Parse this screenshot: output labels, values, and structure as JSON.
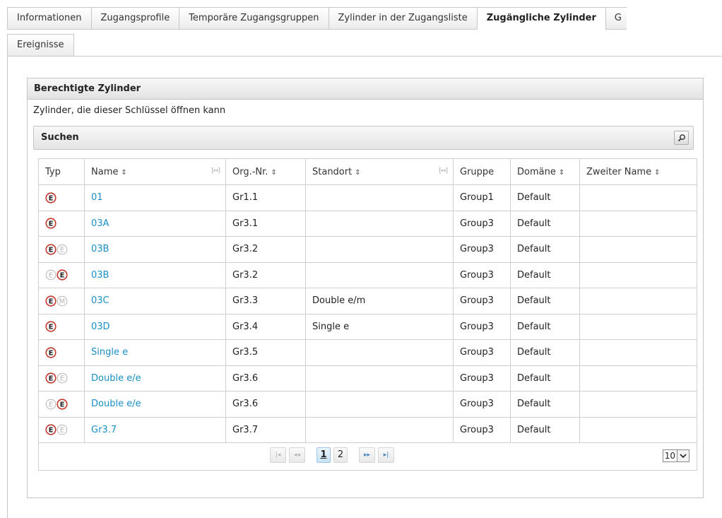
{
  "tabs_row1": [
    {
      "label": "Informationen",
      "active": false
    },
    {
      "label": "Zugangsprofile",
      "active": false
    },
    {
      "label": "Temporäre Zugangsgruppen",
      "active": false
    },
    {
      "label": "Zylinder in der Zugangsliste",
      "active": false
    },
    {
      "label": "Zugängliche Zylinder",
      "active": true
    },
    {
      "label": "G",
      "active": false
    }
  ],
  "tabs_row2": [
    {
      "label": "Ereignisse",
      "active": false
    }
  ],
  "panel": {
    "title": "Berechtigte Zylinder",
    "description": "Zylinder, die dieser Schlüssel öffnen kann",
    "search_label": "Suchen",
    "search_icon": "magnifier-icon"
  },
  "table": {
    "columns": [
      "Typ",
      "Name",
      "Org.-Nr.",
      "Standort",
      "Gruppe",
      "Domäne",
      "Zweiter Name"
    ],
    "sortable": [
      false,
      true,
      true,
      true,
      false,
      true,
      true
    ],
    "resizable": [
      false,
      true,
      false,
      true,
      false,
      false,
      false
    ],
    "rows": [
      {
        "typ": [
          "E"
        ],
        "name": "01",
        "org": "Gr1.1",
        "standort": "",
        "gruppe": "Group1",
        "domaene": "Default",
        "zweiter": ""
      },
      {
        "typ": [
          "E"
        ],
        "name": "03A",
        "org": "Gr3.1",
        "standort": "",
        "gruppe": "Group3",
        "domaene": "Default",
        "zweiter": ""
      },
      {
        "typ": [
          "E",
          "e"
        ],
        "name": "03B",
        "org": "Gr3.2",
        "standort": "",
        "gruppe": "Group3",
        "domaene": "Default",
        "zweiter": ""
      },
      {
        "typ": [
          "e",
          "E"
        ],
        "name": "03B",
        "org": "Gr3.2",
        "standort": "",
        "gruppe": "Group3",
        "domaene": "Default",
        "zweiter": ""
      },
      {
        "typ": [
          "E",
          "m"
        ],
        "name": "03C",
        "org": "Gr3.3",
        "standort": "Double e/m",
        "gruppe": "Group3",
        "domaene": "Default",
        "zweiter": ""
      },
      {
        "typ": [
          "E"
        ],
        "name": "03D",
        "org": "Gr3.4",
        "standort": "Single e",
        "gruppe": "Group3",
        "domaene": "Default",
        "zweiter": ""
      },
      {
        "typ": [
          "E"
        ],
        "name": "Single e",
        "org": "Gr3.5",
        "standort": "",
        "gruppe": "Group3",
        "domaene": "Default",
        "zweiter": ""
      },
      {
        "typ": [
          "E",
          "e"
        ],
        "name": "Double e/e",
        "org": "Gr3.6",
        "standort": "",
        "gruppe": "Group3",
        "domaene": "Default",
        "zweiter": ""
      },
      {
        "typ": [
          "e",
          "E"
        ],
        "name": "Double e/e",
        "org": "Gr3.6",
        "standort": "",
        "gruppe": "Group3",
        "domaene": "Default",
        "zweiter": ""
      },
      {
        "typ": [
          "E",
          "e"
        ],
        "name": "Gr3.7",
        "org": "Gr3.7",
        "standort": "",
        "gruppe": "Group3",
        "domaene": "Default",
        "zweiter": ""
      }
    ]
  },
  "pager": {
    "first": "|◂",
    "prev": "◂◂",
    "pages": [
      "1",
      "2"
    ],
    "current": "1",
    "next": "▸▸",
    "last": "▸|",
    "rows_per_page": "10"
  },
  "colors": {
    "link": "#1a8fc7",
    "icon_active": "#c0392b",
    "icon_inactive": "#b5b5b5"
  }
}
